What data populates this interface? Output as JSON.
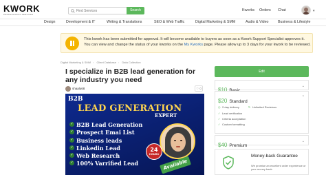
{
  "header": {
    "logo": "KWORK",
    "logo_sub": "PROFESSIONAL SERVICES",
    "search_placeholder": "Find Services",
    "search_button": "Search",
    "nav": [
      "Kworks",
      "Orders",
      "Chat"
    ],
    "accent_color": "#5cb85c"
  },
  "categories": [
    "Design",
    "Development & IT",
    "Writing & Translations",
    "SEO & Web Traffic",
    "Digital Marketing & SMM",
    "Audio & Video",
    "Business & Lifestyle"
  ],
  "notice": {
    "icon": "pause-icon",
    "text_before": "This kwork has been submitted for approval. It will become available to buyers as soon as a Kwork Support Specialist approves it. You can view and change the status of your kworks on the ",
    "link": "My Kworks",
    "text_after": " page. Please allow up to 3 days for your kwork to be reviewed."
  },
  "breadcrumb": [
    "Digital Marketing & SMM",
    "Client Database",
    "Data Collection"
  ],
  "gig": {
    "title": "I specialize in B2B lead generation for any industry you need",
    "seller": "shaalu68",
    "favorites": "0",
    "image": {
      "top_left": "B2B",
      "headline": "LEAD GENERATION",
      "sub": "EXPERT",
      "items": [
        "B2B Lead Generation",
        "Prospect Emai List",
        "Business leads",
        "Linkedin Lead",
        "Web Research",
        "100% Varrified Lead"
      ],
      "badge_number": "24",
      "badge_unit": "HOURS",
      "available": "Available"
    }
  },
  "sidebar": {
    "edit_button": "Edit",
    "packages": [
      {
        "price": "$10",
        "name": "Basic"
      },
      {
        "price": "$20",
        "name": "Standard",
        "features": [
          "2-day delivery",
          "Unlimited Revisions",
          "Lead verification",
          "Criteria acceptation",
          "Custom formatting"
        ]
      },
      {
        "price": "$40",
        "name": "Premium"
      }
    ],
    "guarantee": {
      "title": "Money-back Guarantee",
      "text": "We promise an excellent order experience or your money back."
    }
  }
}
